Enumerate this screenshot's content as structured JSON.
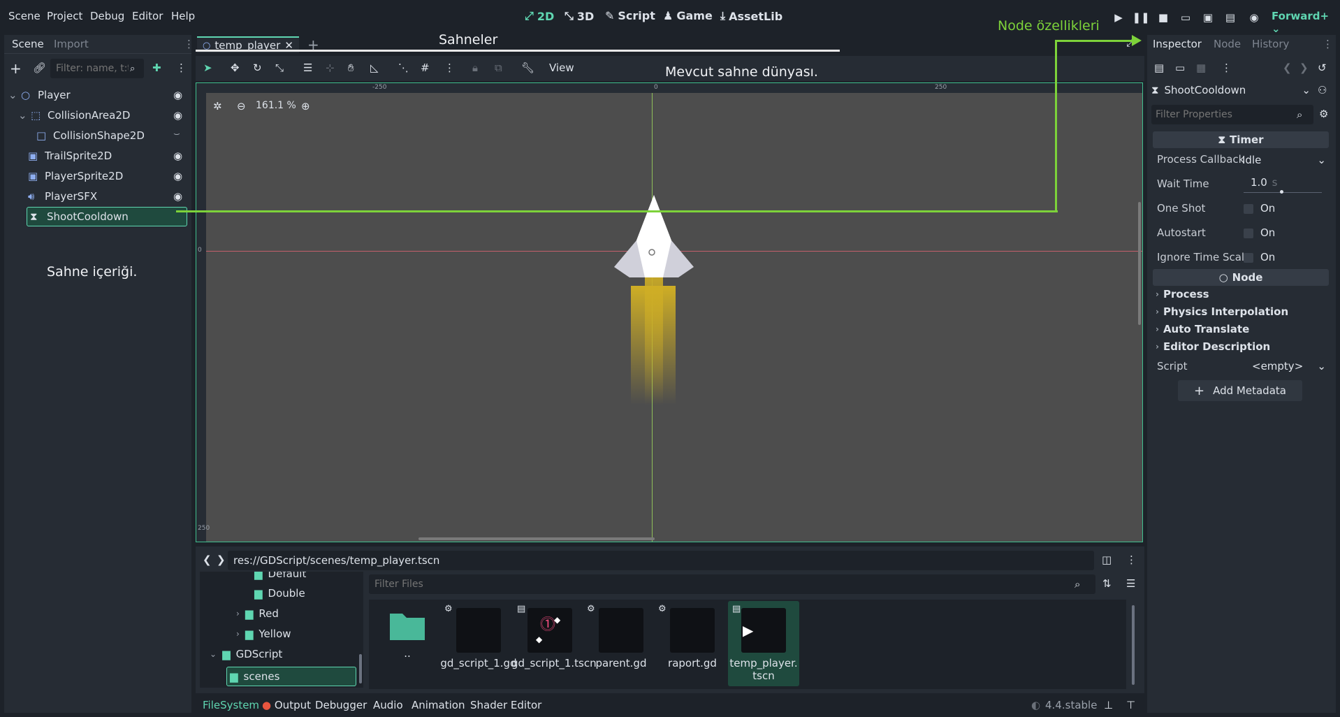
{
  "menu": [
    "Scene",
    "Project",
    "Debug",
    "Editor",
    "Help"
  ],
  "modes": [
    {
      "label": "2D",
      "icon": "2d-icon",
      "active": true
    },
    {
      "label": "3D",
      "icon": "3d-icon",
      "active": false
    },
    {
      "label": "Script",
      "icon": "script-icon",
      "active": false
    },
    {
      "label": "Game",
      "icon": "game-icon",
      "active": false
    },
    {
      "label": "AssetLib",
      "icon": "assetlib-icon",
      "active": false
    }
  ],
  "renderer": "Forward+",
  "scene_dock": {
    "tabs": [
      "Scene",
      "Import"
    ],
    "filter_placeholder": "Filter: name, t:t",
    "nodes": [
      {
        "name": "Player",
        "icon": "node2d-icon",
        "visible_toggle": true,
        "selected": false
      },
      {
        "name": "CollisionArea2D",
        "icon": "area2d-icon",
        "visible_toggle": true,
        "selected": false
      },
      {
        "name": "CollisionShape2D",
        "icon": "collision-shape-icon",
        "visible_toggle": false,
        "selected": false
      },
      {
        "name": "TrailSprite2D",
        "icon": "sprite2d-icon",
        "visible_toggle": true,
        "selected": false
      },
      {
        "name": "PlayerSprite2D",
        "icon": "sprite2d-icon",
        "visible_toggle": true,
        "selected": false
      },
      {
        "name": "PlayerSFX",
        "icon": "audio-icon",
        "visible_toggle": true,
        "selected": false
      },
      {
        "name": "ShootCooldown",
        "icon": "timer-icon",
        "visible_toggle": false,
        "selected": true
      }
    ]
  },
  "editor": {
    "scene_tab": "temp_player",
    "zoom": "161.1 %",
    "view_menu": "View",
    "ruler_labels": [
      "-250",
      "0",
      "250"
    ],
    "vruler_labels": [
      "0",
      "250"
    ]
  },
  "annotations": {
    "scenes": "Sahneler",
    "world": "Mevcut sahne dünyası.",
    "properties": "Node özellikleri",
    "content": "Sahne içeriği."
  },
  "inspector": {
    "tabs": [
      "Inspector",
      "Node",
      "History"
    ],
    "object": "ShootCooldown",
    "filter_placeholder": "Filter Properties",
    "section_timer": "Timer",
    "properties": [
      {
        "label": "Process Callback",
        "value": "Idle"
      },
      {
        "label": "Wait Time",
        "value": "1.0",
        "unit": "s"
      },
      {
        "label": "One Shot",
        "value": "On"
      },
      {
        "label": "Autostart",
        "value": "On"
      },
      {
        "label": "Ignore Time Scal",
        "value": "On"
      }
    ],
    "section_node": "Node",
    "categories": [
      "Process",
      "Physics Interpolation",
      "Auto Translate",
      "Editor Description"
    ],
    "script_label": "Script",
    "script_value": "<empty>",
    "add_metadata": "Add Metadata"
  },
  "filesystem": {
    "path": "res://GDScript/scenes/temp_player.tscn",
    "filter_placeholder": "Filter Files",
    "tree": [
      {
        "label": "Default"
      },
      {
        "label": "Double"
      },
      {
        "label": "Red"
      },
      {
        "label": "Yellow"
      },
      {
        "label": "GDScript"
      },
      {
        "label": "scenes"
      }
    ],
    "files": [
      {
        "label": ".."
      },
      {
        "label": "gd_script_1.gd"
      },
      {
        "label": "gd_script_1.tscn"
      },
      {
        "label": "parent.gd"
      },
      {
        "label": "raport.gd"
      },
      {
        "label": "temp_player.tscn"
      }
    ]
  },
  "bottom_tabs": [
    "FileSystem",
    "Output",
    "Debugger",
    "Audio",
    "Animation",
    "Shader Editor"
  ],
  "version": "4.4.stable",
  "colors": {
    "accent": "#5fd6b1",
    "annotation": "#7dd23a",
    "viewport": "#4d4d4d"
  }
}
